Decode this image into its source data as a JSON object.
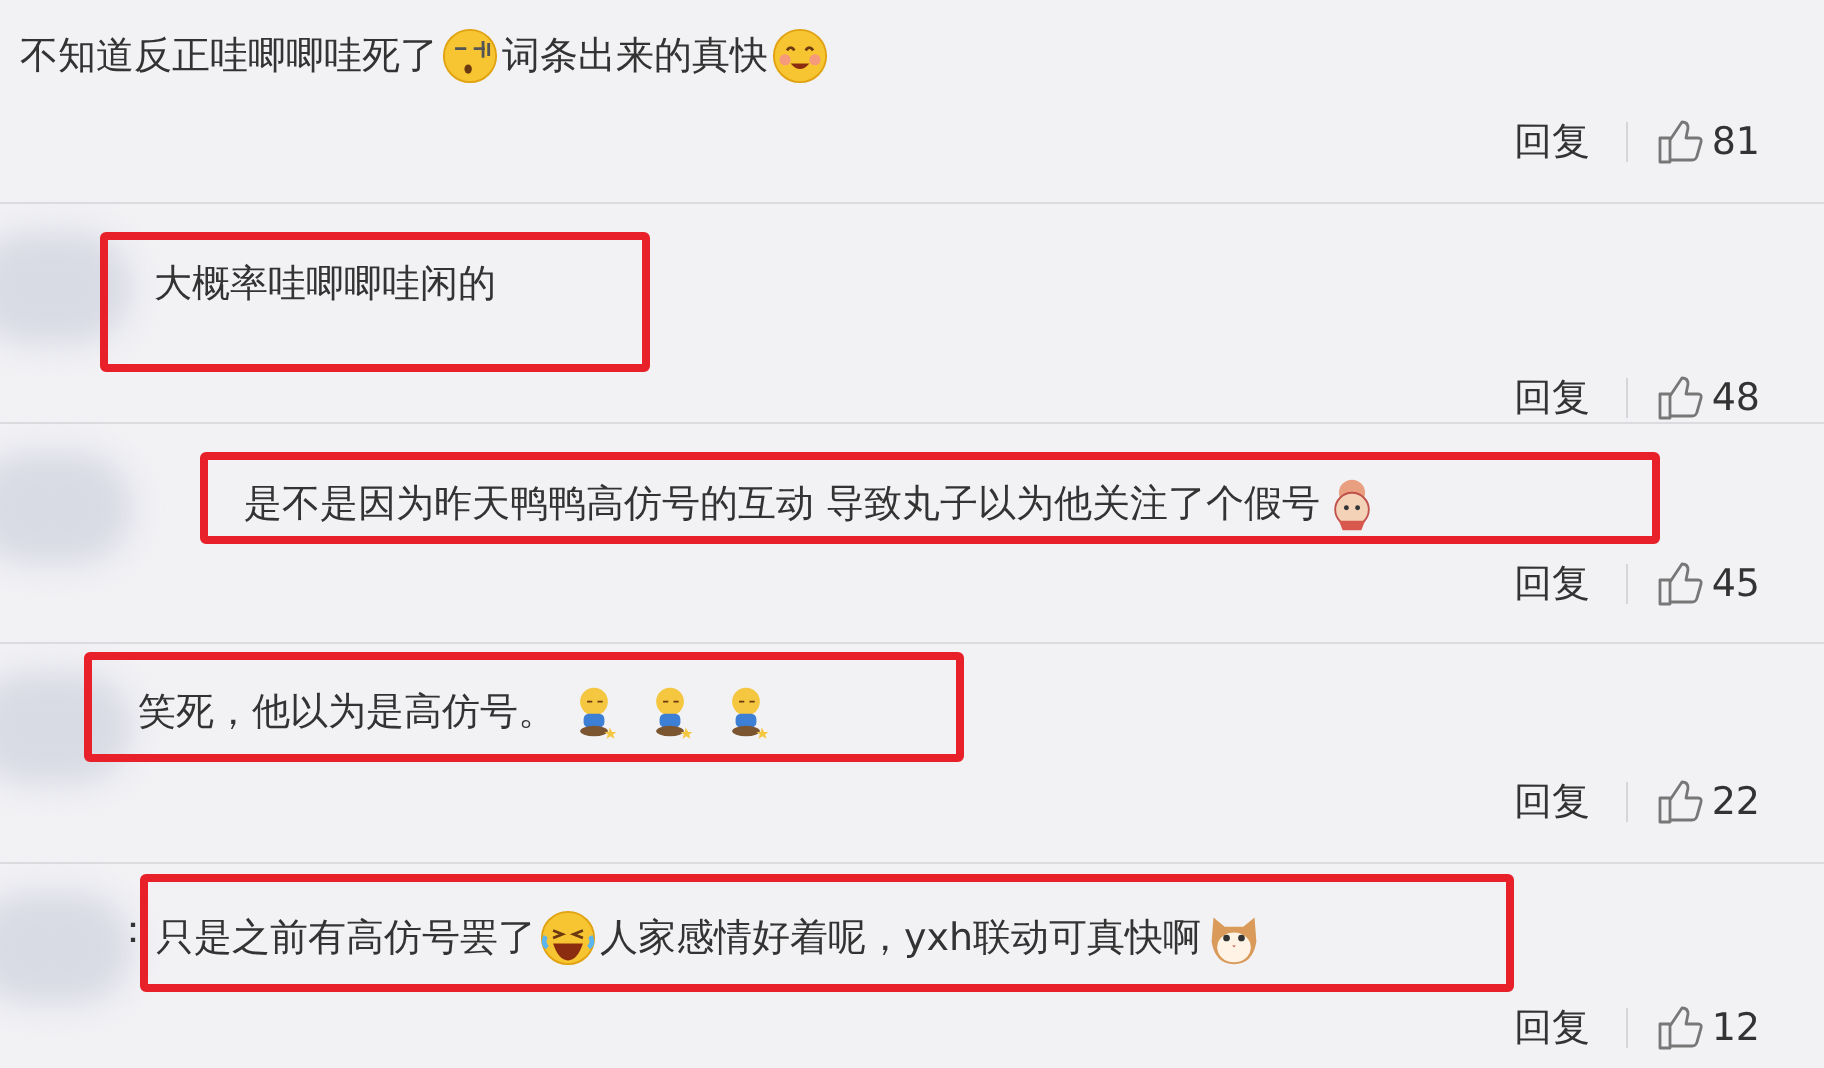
{
  "comments": [
    {
      "highlighted": false,
      "segments": [
        {
          "kind": "text",
          "text": "不知道反正哇唧唧哇死了"
        },
        {
          "kind": "sleepy"
        },
        {
          "kind": "text",
          "text": "词条出来的真快"
        },
        {
          "kind": "smile"
        }
      ],
      "reply": "回复",
      "likes": "81"
    },
    {
      "highlighted": true,
      "segments": [
        {
          "kind": "text",
          "text": "大概率哇唧唧哇闲的"
        }
      ],
      "reply": "回复",
      "likes": "48"
    },
    {
      "highlighted": true,
      "segments": [
        {
          "kind": "text",
          "text": "是不是因为昨天鸭鸭高仿号的互动 导致丸子以为他关注了个假号"
        },
        {
          "kind": "doll"
        }
      ],
      "reply": "回复",
      "likes": "45"
    },
    {
      "highlighted": true,
      "segments": [
        {
          "kind": "text",
          "text": "笑死，他以为是高仿号。"
        },
        {
          "kind": "figure"
        },
        {
          "kind": "figure"
        },
        {
          "kind": "figure"
        }
      ],
      "reply": "回复",
      "likes": "22"
    },
    {
      "highlighted": true,
      "prefix": "：",
      "segments": [
        {
          "kind": "text",
          "text": "只是之前有高仿号罢了"
        },
        {
          "kind": "laugh"
        },
        {
          "kind": "text",
          "text": "人家感情好着呢，yxh联动可真快啊"
        },
        {
          "kind": "cat"
        }
      ],
      "reply": "回复",
      "likes": "12"
    }
  ]
}
